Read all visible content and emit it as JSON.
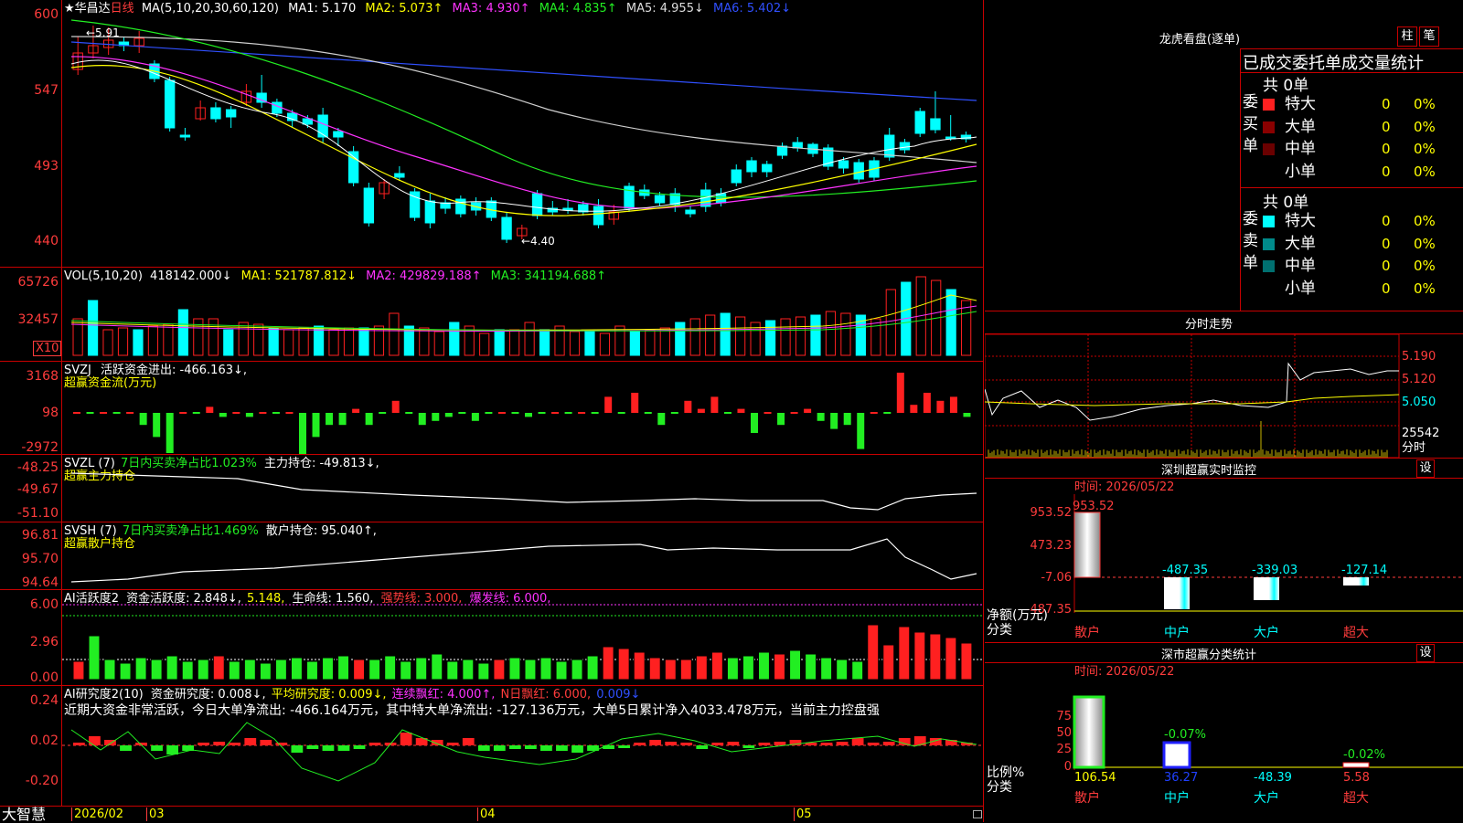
{
  "colors": {
    "bg": "#000000",
    "grid": "#c80000",
    "up": "#ff2020",
    "down": "#00ffff",
    "green": "#22ee22",
    "yellow": "#ffff00",
    "magenta": "#ff33ff",
    "white": "#ffffff",
    "cyan": "#00ffff"
  },
  "price_panel": {
    "star": "★",
    "stock_name": "华昌达",
    "period": "日线",
    "ma_spec": "MA(5,10,20,30,60,120)",
    "ma1": "MA1: 5.170",
    "ma2": "MA2: 5.073↑",
    "ma3": "MA3: 4.930↑",
    "ma4": "MA4: 4.835↑",
    "ma5": "MA5: 4.955↓",
    "ma6": "MA6: 5.402↓",
    "y_labels": [
      "600",
      "547",
      "493",
      "440"
    ],
    "high_note": "←5.91",
    "low_note": "←4.40"
  },
  "vol_panel": {
    "title": "VOL(5,10,20)",
    "value": "418142.000↓",
    "ma1": "MA1: 521787.812↓",
    "ma2": "MA2: 429829.188↑",
    "ma3": "MA3: 341194.688↑",
    "y_labels": [
      "65726",
      "32457"
    ],
    "unit": "X10"
  },
  "svzj_panel": {
    "title": "SVZJ",
    "label": "活跃资金进出: -466.163↓,",
    "subtitle": "超赢资金流(万元)",
    "y_labels": [
      "3168",
      "98",
      "-2972"
    ]
  },
  "svzl_panel": {
    "title": "SVZL (7)",
    "ratio": "7日内买卖净占比1.023%",
    "holding": "主力持仓: -49.813↓,",
    "subtitle": "超赢主力持仓",
    "y_labels": [
      "-48.25",
      "-49.67",
      "-51.10"
    ]
  },
  "svsh_panel": {
    "title": "SVSH (7)",
    "ratio": "7日内买卖净占比1.469%",
    "holding": "散户持仓: 95.040↑,",
    "subtitle": "超赢散户持仓",
    "y_labels": [
      "96.81",
      "95.70",
      "94.64"
    ]
  },
  "ai_active_panel": {
    "title": "AI活跃度2",
    "fund": "资金活跃度: 2.848↓,",
    "val2": "5.148,",
    "life": "生命线: 1.560,",
    "strong": "强势线: 3.000,",
    "burst": "爆发线: 6.000,",
    "y_labels": [
      "6.00",
      "2.96",
      "0.00"
    ]
  },
  "ai_research_panel": {
    "title": "AI研究度2(10)",
    "fund": "资金研究度: 0.008↓,",
    "avg": "平均研究度: 0.009↓,",
    "cont": "连续飘红: 4.000↑,",
    "n_days": "N日飘红: 6.000,",
    "last": "0.009↓",
    "summary": "近期大资金非常活跃，今日大单净流出: -466.164万元，其中特大单净流出: -127.136万元，大单5日累计净入4033.478万元，当前主力控盘强",
    "y_labels": [
      "0.24",
      "0.02",
      "-0.20"
    ]
  },
  "bottom_bar": {
    "brand": "大智慧",
    "dates": [
      "2026/02",
      "03",
      "04",
      "05"
    ]
  },
  "lhb": {
    "title": "龙虎看盘(逐单)",
    "btn_column": "柱",
    "btn_pen": "笔",
    "tabs": "已成交委托单成交量统计",
    "buy_side": "委买单",
    "sell_side": "委卖单",
    "buy_total": "共 0单",
    "sell_total": "共 0单",
    "rows": [
      {
        "label": "特大",
        "value": "0",
        "pct": "0%"
      },
      {
        "label": "大单",
        "value": "0",
        "pct": "0%"
      },
      {
        "label": "中单",
        "value": "0",
        "pct": "0%"
      },
      {
        "label": "小单",
        "value": "0",
        "pct": "0%"
      }
    ]
  },
  "intraday": {
    "title": "分时走势",
    "right_labels": [
      "5.190",
      "5.120",
      "5.050",
      "25542",
      "分时"
    ]
  },
  "sz_monitor": {
    "title": "深圳超赢实时监控",
    "settings": "设",
    "time": "时间: 2026/05/22",
    "y_labels": [
      "953.52",
      "473.23",
      "-7.06",
      "-487.35"
    ],
    "top_value": "953.52",
    "values": [
      "-487.35",
      "-339.03",
      "-127.14"
    ],
    "ylabel": "净额(万元)",
    "xlabel": "分类",
    "categories": [
      "散户",
      "中户",
      "大户",
      "超大"
    ]
  },
  "sz_class": {
    "title": "深市超赢分类统计",
    "settings": "设",
    "time": "时间: 2026/05/22",
    "y_labels": [
      "75",
      "50",
      "25",
      "0"
    ],
    "top_values": [
      "-0.07%",
      "-0.02%"
    ],
    "values": [
      "106.54",
      "36.27",
      "-48.39",
      "5.58"
    ],
    "ylabel": "比例%",
    "xlabel": "分类",
    "categories": [
      "散户",
      "中户",
      "大户",
      "超大"
    ]
  }
}
